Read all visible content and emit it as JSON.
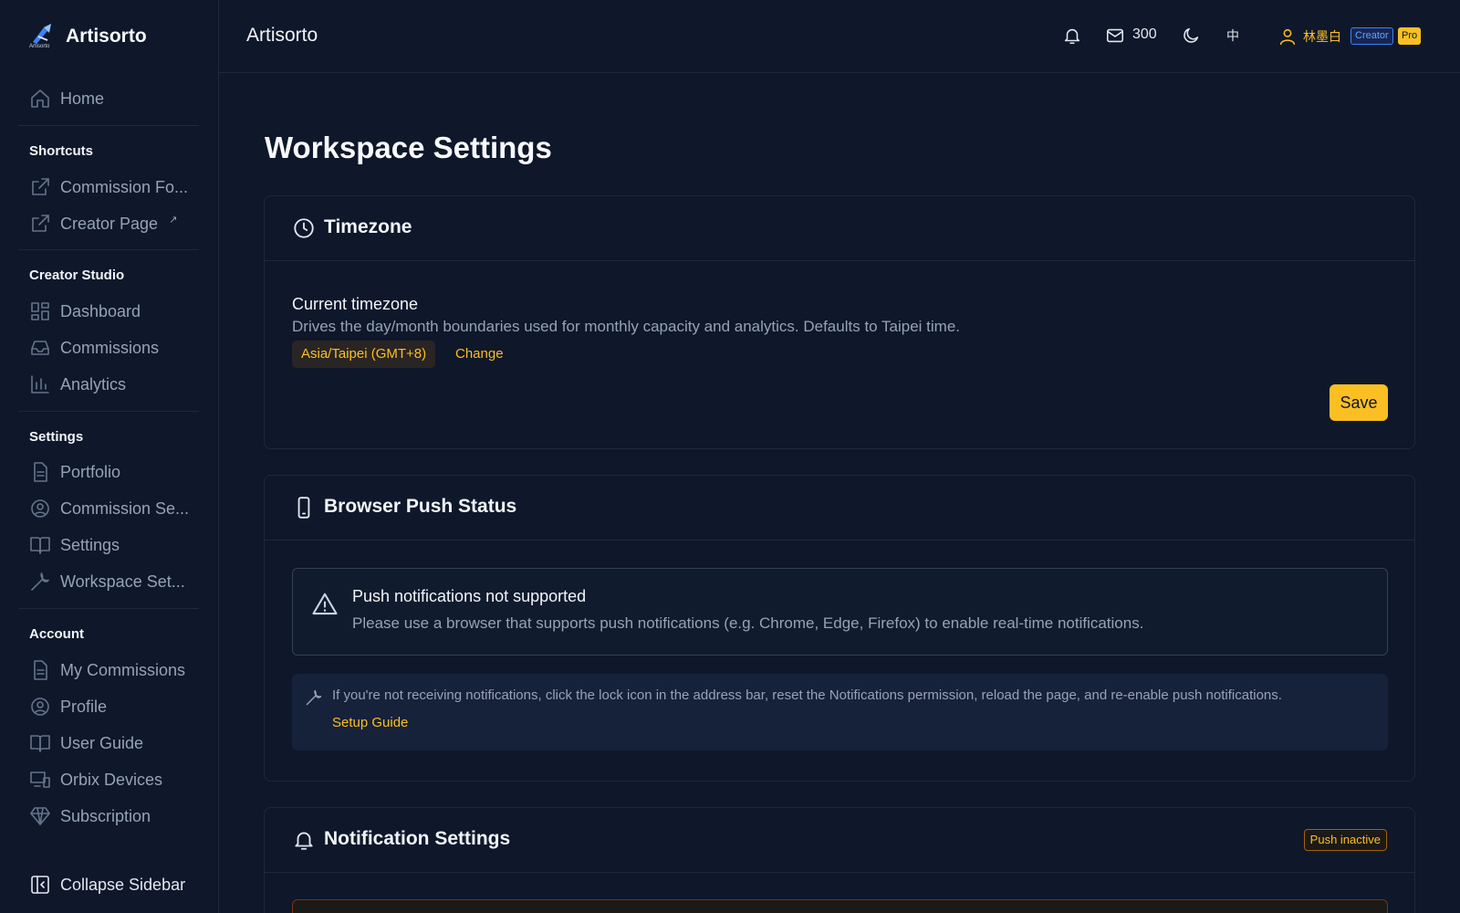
{
  "brand": {
    "name": "Artisorto",
    "logo_text": "Artisorto"
  },
  "sidebar": {
    "home": "Home",
    "shortcuts": {
      "title": "Shortcuts",
      "items": [
        "Commission Fo...",
        "Creator Page"
      ],
      "external_mark": "↗"
    },
    "creator_studio": {
      "title": "Creator Studio",
      "items": [
        "Dashboard",
        "Commissions",
        "Analytics"
      ]
    },
    "settings": {
      "title": "Settings",
      "items": [
        "Portfolio",
        "Commission Se...",
        "Settings",
        "Workspace Set..."
      ]
    },
    "account": {
      "title": "Account",
      "items": [
        "My Commissions",
        "Profile",
        "User Guide",
        "Orbix Devices",
        "Subscription"
      ]
    },
    "collapse": "Collapse Sidebar"
  },
  "header": {
    "title": "Artisorto",
    "mail_count": "300",
    "language": "中",
    "user_name": "林墨白",
    "badge_creator": "Creator",
    "badge_pro": "Pro"
  },
  "page": {
    "title": "Workspace Settings"
  },
  "timezone": {
    "title": "Timezone",
    "label": "Current timezone",
    "description": "Drives the day/month boundaries used for monthly capacity and analytics. Defaults to Taipei time.",
    "value": "Asia/Taipei (GMT+8)",
    "change": "Change",
    "save": "Save"
  },
  "push": {
    "title": "Browser Push Status",
    "alert_title": "Push notifications not supported",
    "alert_desc": "Please use a browser that supports push notifications (e.g. Chrome, Edge, Firefox) to enable real-time notifications.",
    "hint": "If you're not receiving notifications, click the lock icon in the address bar, reset the Notifications permission, reload the page, and re-enable push notifications.",
    "guide": "Setup Guide"
  },
  "notifications": {
    "title": "Notification Settings",
    "status_badge": "Push inactive"
  },
  "colors": {
    "accent": "#fbbf24",
    "background": "#0f172a",
    "border": "#1e293b"
  }
}
